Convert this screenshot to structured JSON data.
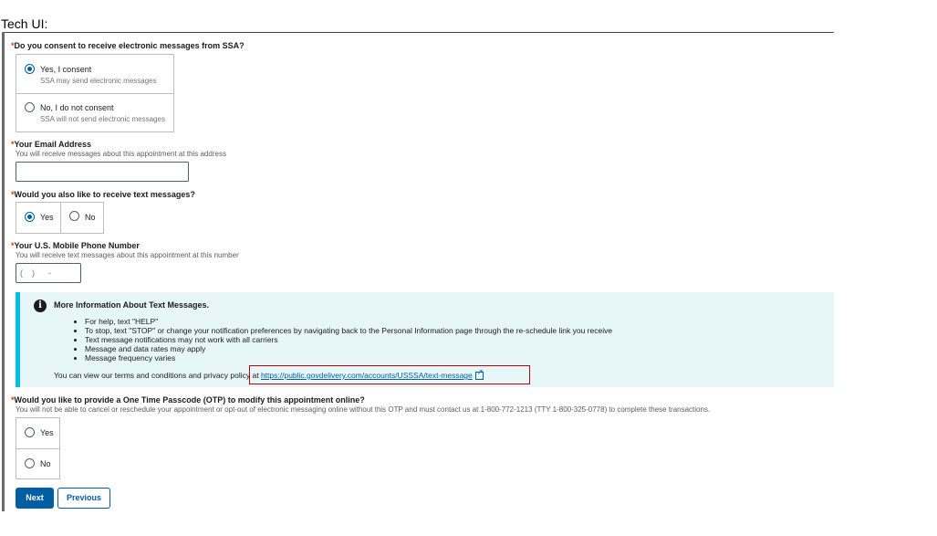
{
  "page": {
    "heading": "Tech UI:"
  },
  "colors": {
    "primary": "#005ea2",
    "required": "#d63e04",
    "alert_bg": "#e7f6f8",
    "alert_border": "#00bde3",
    "highlight": "#c00000"
  },
  "consent": {
    "required_mark": "*",
    "label": "Do you consent to receive electronic messages from SSA?",
    "options": [
      {
        "label": "Yes, I consent",
        "description": "SSA may send electronic messages",
        "checked": true
      },
      {
        "label": "No, I do not consent",
        "description": "SSA will not send electronic messages",
        "checked": false
      }
    ]
  },
  "email": {
    "required_mark": "*",
    "label": "Your Email Address",
    "hint": "You will receive messages about this appointment at this address",
    "value": ""
  },
  "text_messages": {
    "required_mark": "*",
    "label": "Would you also like to receive text messages?",
    "options": [
      {
        "label": "Yes",
        "checked": true
      },
      {
        "label": "No",
        "checked": false
      }
    ]
  },
  "phone": {
    "required_mark": "*",
    "label": "Your U.S. Mobile Phone Number",
    "hint": "You will receive text messages about this appointment at this number",
    "placeholder": "(    )      -"
  },
  "info_alert": {
    "icon": "info-icon",
    "title": "More Information About Text Messages.",
    "items": [
      "For help, text \"HELP\"",
      "To stop, text \"STOP\" or change your notification preferences by navigating back to the Personal Information page through the re-schedule link you receive",
      "Text message notifications may not work with all carriers",
      "Message and data rates may apply",
      "Message frequency varies"
    ],
    "footer_text": "You can view our terms and conditions and privacy policy at ",
    "link_text": "https://public.govdelivery.com/accounts/USSSA/text-message",
    "link_icon": "external-link-icon"
  },
  "otp": {
    "required_mark": "*",
    "label": "Would you like to provide a One Time Passcode (OTP) to modify this appointment online?",
    "hint": "You will not be able to cancel or reschedule your appointment or opt-out of electronic messaging online without this OTP and must contact us at 1-800-772-1213 (TTY 1-800-325-0778) to complete these transactions.",
    "options": [
      {
        "label": "Yes",
        "checked": false
      },
      {
        "label": "No",
        "checked": false
      }
    ]
  },
  "buttons": {
    "next": "Next",
    "previous": "Previous"
  }
}
